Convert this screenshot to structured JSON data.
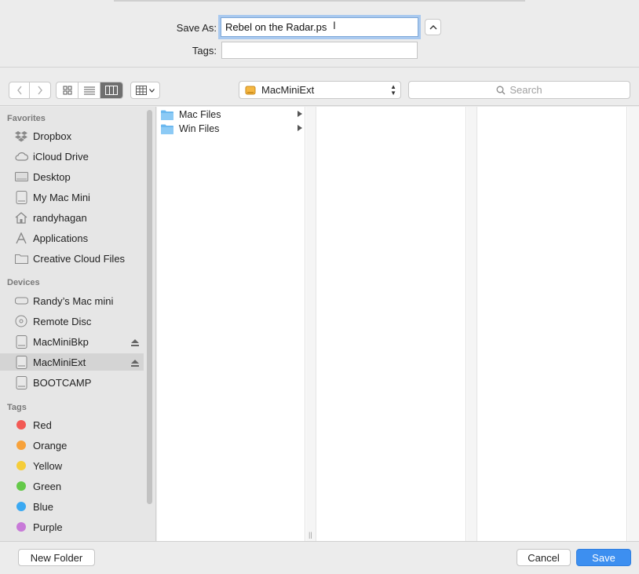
{
  "header": {
    "save_as_label": "Save As:",
    "save_as_value": "Rebel on the Radar.ps",
    "tags_label": "Tags:",
    "tags_value": ""
  },
  "toolbar": {
    "location": "MacMiniExt",
    "search_placeholder": "Search",
    "active_view": "column"
  },
  "sidebar": {
    "favorites_title": "Favorites",
    "favorites": [
      {
        "label": "Dropbox",
        "icon": "dropbox-icon"
      },
      {
        "label": "iCloud Drive",
        "icon": "cloud-icon"
      },
      {
        "label": "Desktop",
        "icon": "desktop-icon"
      },
      {
        "label": "My Mac Mini",
        "icon": "drive-icon"
      },
      {
        "label": "randyhagan",
        "icon": "home-icon"
      },
      {
        "label": "Applications",
        "icon": "applications-icon"
      },
      {
        "label": "Creative Cloud Files",
        "icon": "folder-icon"
      }
    ],
    "devices_title": "Devices",
    "devices": [
      {
        "label": "Randy’s Mac mini",
        "icon": "mac-mini-icon"
      },
      {
        "label": "Remote Disc",
        "icon": "disc-icon"
      },
      {
        "label": "MacMiniBkp",
        "icon": "drive-icon",
        "eject": true
      },
      {
        "label": "MacMiniExt",
        "icon": "drive-icon",
        "eject": true,
        "selected": true
      },
      {
        "label": "BOOTCAMP",
        "icon": "drive-icon"
      }
    ],
    "tags_title": "Tags",
    "tags": [
      {
        "label": "Red",
        "color": "#f25a55"
      },
      {
        "label": "Orange",
        "color": "#f7a23b"
      },
      {
        "label": "Yellow",
        "color": "#f5cd3a"
      },
      {
        "label": "Green",
        "color": "#64c949"
      },
      {
        "label": "Blue",
        "color": "#3ba9f2"
      },
      {
        "label": "Purple",
        "color": "#c87ad8"
      }
    ]
  },
  "browser": {
    "column1": [
      {
        "label": "Mac Files"
      },
      {
        "label": "Win Files"
      }
    ]
  },
  "footer": {
    "new_folder_label": "New Folder",
    "cancel_label": "Cancel",
    "save_label": "Save"
  }
}
